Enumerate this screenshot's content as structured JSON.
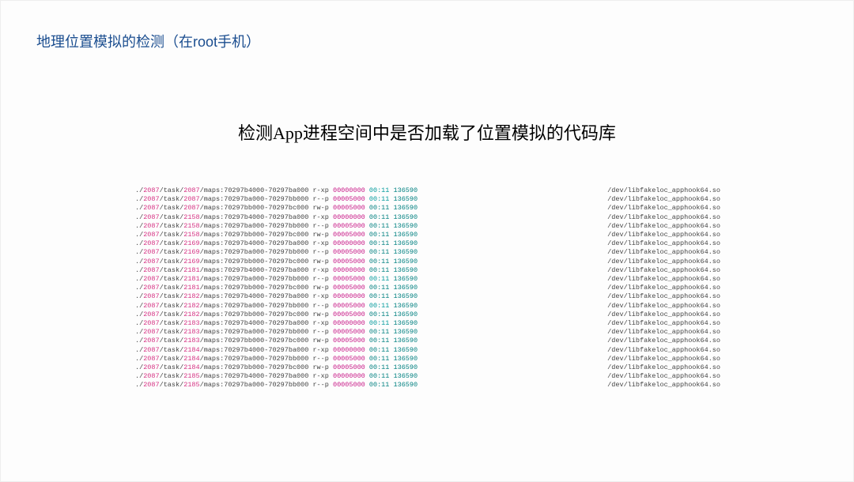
{
  "title": "地理位置模拟的检测（在root手机）",
  "subtitle": "检测App进程空间中是否加载了位置模拟的代码库",
  "common": {
    "prefix": "./",
    "pid1": "2087",
    "task": "/task/",
    "maps": "/maps:",
    "addr_r1": "70297b4000-70297ba000",
    "addr_r2": "70297ba000-70297bb000",
    "addr_r3": "70297bb000-70297bc000",
    "perm_xp": " r-xp ",
    "perm_rp": " r--p ",
    "perm_wp": " rw-p ",
    "off_zero": "00000000",
    "off_five": "00005000",
    "dev": " 00:11",
    "inode": " 136590",
    "path": "/dev/libfakeloc_apphook64.so"
  },
  "rows": [
    {
      "tid": "2087",
      "addr": "addr_r1",
      "perm": "perm_xp",
      "off": "off_zero",
      "dev_c": "cyan",
      "inode_c": "teal"
    },
    {
      "tid": "2087",
      "addr": "addr_r2",
      "perm": "perm_rp",
      "off": "off_five",
      "dev_c": "cyan",
      "inode_c": "teal"
    },
    {
      "tid": "2087",
      "addr": "addr_r3",
      "perm": "perm_wp",
      "off": "off_five",
      "dev_c": "teal",
      "inode_c": "teal"
    },
    {
      "tid": "2158",
      "addr": "addr_r1",
      "perm": "perm_xp",
      "off": "off_zero",
      "dev_c": "teal",
      "inode_c": "teal"
    },
    {
      "tid": "2158",
      "addr": "addr_r2",
      "perm": "perm_rp",
      "off": "off_five",
      "dev_c": "teal",
      "inode_c": "teal"
    },
    {
      "tid": "2158",
      "addr": "addr_r3",
      "perm": "perm_wp",
      "off": "off_five",
      "dev_c": "teal",
      "inode_c": "teal"
    },
    {
      "tid": "2169",
      "addr": "addr_r1",
      "perm": "perm_xp",
      "off": "off_zero",
      "dev_c": "teal",
      "inode_c": "teal"
    },
    {
      "tid": "2169",
      "addr": "addr_r2",
      "perm": "perm_rp",
      "off": "off_five",
      "dev_c": "teal",
      "inode_c": "teal"
    },
    {
      "tid": "2169",
      "addr": "addr_r3",
      "perm": "perm_wp",
      "off": "off_five",
      "dev_c": "teal",
      "inode_c": "teal"
    },
    {
      "tid": "2181",
      "addr": "addr_r1",
      "perm": "perm_xp",
      "off": "off_zero",
      "dev_c": "teal",
      "inode_c": "teal"
    },
    {
      "tid": "2181",
      "addr": "addr_r2",
      "perm": "perm_rp",
      "off": "off_five",
      "dev_c": "cyan",
      "inode_c": "teal"
    },
    {
      "tid": "2181",
      "addr": "addr_r3",
      "perm": "perm_wp",
      "off": "off_five",
      "dev_c": "teal",
      "inode_c": "teal"
    },
    {
      "tid": "2182",
      "addr": "addr_r1",
      "perm": "perm_xp",
      "off": "off_zero",
      "dev_c": "teal",
      "inode_c": "teal"
    },
    {
      "tid": "2182",
      "addr": "addr_r2",
      "perm": "perm_rp",
      "off": "off_five",
      "dev_c": "cyan",
      "inode_c": "teal"
    },
    {
      "tid": "2182",
      "addr": "addr_r3",
      "perm": "perm_wp",
      "off": "off_five",
      "dev_c": "teal",
      "inode_c": "teal"
    },
    {
      "tid": "2183",
      "addr": "addr_r1",
      "perm": "perm_xp",
      "off": "off_zero",
      "dev_c": "cyan",
      "inode_c": "teal"
    },
    {
      "tid": "2183",
      "addr": "addr_r2",
      "perm": "perm_rp",
      "off": "off_five",
      "dev_c": "teal",
      "inode_c": "teal"
    },
    {
      "tid": "2183",
      "addr": "addr_r3",
      "perm": "perm_wp",
      "off": "off_five",
      "dev_c": "teal",
      "inode_c": "teal"
    },
    {
      "tid": "2184",
      "addr": "addr_r1",
      "perm": "perm_xp",
      "off": "off_zero",
      "dev_c": "teal",
      "inode_c": "teal"
    },
    {
      "tid": "2184",
      "addr": "addr_r2",
      "perm": "perm_rp",
      "off": "off_five",
      "dev_c": "teal",
      "inode_c": "teal"
    },
    {
      "tid": "2184",
      "addr": "addr_r3",
      "perm": "perm_wp",
      "off": "off_five",
      "dev_c": "teal",
      "inode_c": "teal"
    },
    {
      "tid": "2185",
      "addr": "addr_r1",
      "perm": "perm_xp",
      "off": "off_zero",
      "dev_c": "teal",
      "inode_c": "teal"
    },
    {
      "tid": "2185",
      "addr": "addr_r2",
      "perm": "perm_rp",
      "off": "off_five",
      "dev_c": "teal",
      "inode_c": "teal"
    }
  ]
}
